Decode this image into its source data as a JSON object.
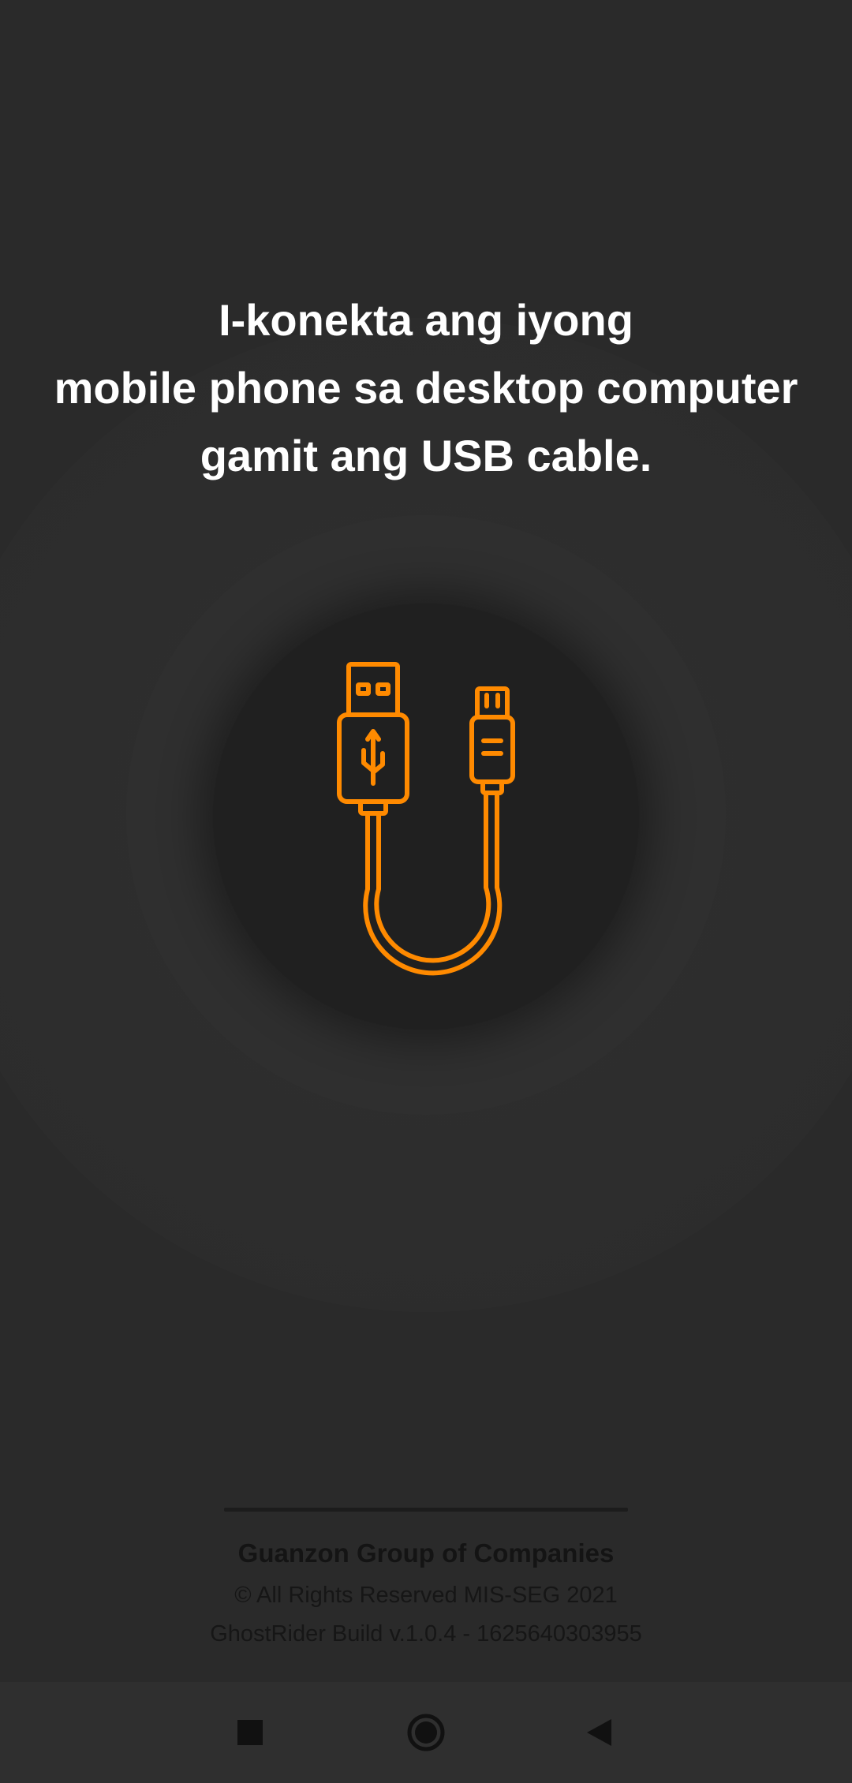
{
  "instructions": {
    "line1": "I-konekta ang iyong",
    "line2": "mobile phone sa desktop computer",
    "line3": "gamit ang USB cable."
  },
  "illustration": {
    "icon": "usb-cable-icon",
    "stroke_color": "#ff8a00",
    "background_color": "#202020"
  },
  "footer": {
    "company": "Guanzon Group of Companies",
    "rights": "© All Rights Reserved MIS-SEG 2021",
    "build": "GhostRider Build v.1.0.4 - 1625640303955"
  },
  "navigation_bar": {
    "recents_icon": "square-recents-icon",
    "home_icon": "circle-home-icon",
    "back_icon": "triangle-back-icon"
  }
}
